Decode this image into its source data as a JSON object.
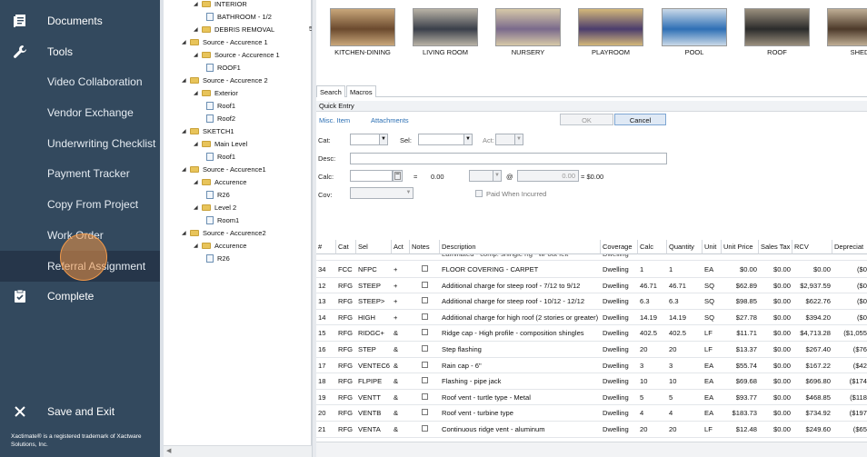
{
  "sidebar": {
    "documents": "Documents",
    "tools": "Tools",
    "subitems": [
      "Video Collaboration",
      "Vendor Exchange",
      "Underwriting Checklist",
      "Payment Tracker",
      "Copy From Project",
      "Work Order",
      "Referral Assignment"
    ],
    "complete": "Complete",
    "save_exit": "Save and Exit",
    "trademark": "Xactimate® is a registered trademark of Xactware Solutions, Inc."
  },
  "tree": [
    {
      "label": "INTERIOR",
      "type": "folder",
      "indent": 2
    },
    {
      "label": "BATHROOM - 1/2",
      "type": "doc",
      "indent": 3
    },
    {
      "label": "DEBRIS REMOVAL",
      "type": "folder",
      "indent": 2
    },
    {
      "label": "Source - Accurence 1",
      "type": "folder",
      "indent": 1
    },
    {
      "label": "Source - Accurence 1",
      "type": "folder",
      "indent": 2
    },
    {
      "label": "ROOF1",
      "type": "doc",
      "indent": 3
    },
    {
      "label": "Source - Accurence 2",
      "type": "folder",
      "indent": 1
    },
    {
      "label": "Exterior",
      "type": "folder",
      "indent": 2
    },
    {
      "label": "Roof1",
      "type": "doc",
      "indent": 3
    },
    {
      "label": "Roof2",
      "type": "doc",
      "indent": 3
    },
    {
      "label": "SKETCH1",
      "type": "folder",
      "indent": 1
    },
    {
      "label": "Main Level",
      "type": "folder",
      "indent": 2
    },
    {
      "label": "Roof1",
      "type": "doc",
      "indent": 3
    },
    {
      "label": "Source - Accurence1",
      "type": "folder",
      "indent": 1
    },
    {
      "label": "Accurence",
      "type": "folder",
      "indent": 2
    },
    {
      "label": "R26",
      "type": "doc",
      "indent": 3
    },
    {
      "label": "Level 2",
      "type": "folder",
      "indent": 2
    },
    {
      "label": "Room1",
      "type": "doc",
      "indent": 3
    },
    {
      "label": "Source - Accurence2",
      "type": "folder",
      "indent": 1
    },
    {
      "label": "Accurence",
      "type": "folder",
      "indent": 2
    },
    {
      "label": "R26",
      "type": "doc",
      "indent": 3
    }
  ],
  "tree_partial": "5",
  "thumbs": [
    {
      "label": "KITCHEN-DINING",
      "c1": "#6b4a2e",
      "c2": "#c9a77a"
    },
    {
      "label": "LIVING ROOM",
      "c1": "#3a3f4a",
      "c2": "#b9b3a6"
    },
    {
      "label": "NURSERY",
      "c1": "#7a6a8c",
      "c2": "#d7c9a8"
    },
    {
      "label": "PLAYROOM",
      "c1": "#4b3d6d",
      "c2": "#d4b87a"
    },
    {
      "label": "POOL",
      "c1": "#2e6fb5",
      "c2": "#c9d9e8"
    },
    {
      "label": "ROOF",
      "c1": "#2b2b2b",
      "c2": "#9a8f7d"
    },
    {
      "label": "SHED",
      "c1": "#4d3a2a",
      "c2": "#bfae95"
    }
  ],
  "tabs": [
    "Search",
    "Macros"
  ],
  "quick_entry": {
    "title": "Quick Entry",
    "misc_item": "Misc. Item",
    "attachments": "Attachments",
    "ok": "OK",
    "cancel": "Cancel",
    "cat_label": "Cat:",
    "sel_label": "Sel:",
    "act_label": "Act:",
    "desc_label": "Desc:",
    "calc_label": "Calc:",
    "cov_label": "Cov:",
    "eq1": "=",
    "calc_value": "0.00",
    "at": "@",
    "price_value": "0.00",
    "total": "= $0.00",
    "paid_when_incurred": "Paid When Incurred"
  },
  "grid": {
    "headers": [
      "#",
      "Cat",
      "Sel",
      "Act",
      "Notes",
      "Description",
      "Coverage",
      "Calc",
      "Quantity",
      "Unit",
      "Unit Price",
      "Sales Tax",
      "RCV",
      "Depreciat"
    ],
    "partial_row": [
      "",
      "",
      "",
      "",
      "",
      "Laminated - comp. shingle rfg - w/ out felt",
      "Dwelling",
      "",
      "",
      "",
      "",
      "",
      "",
      ""
    ],
    "rows": [
      [
        "34",
        "FCC",
        "NFPC",
        "+",
        "",
        "FLOOR COVERING - CARPET",
        "Dwelling",
        "1",
        "1",
        "EA",
        "$0.00",
        "$0.00",
        "$0.00",
        "($0"
      ],
      [
        "12",
        "RFG",
        "STEEP",
        "+",
        "",
        "Additional charge for steep roof - 7/12 to 9/12",
        "Dwelling",
        "46.71",
        "46.71",
        "SQ",
        "$62.89",
        "$0.00",
        "$2,937.59",
        "($0"
      ],
      [
        "13",
        "RFG",
        "STEEP>",
        "+",
        "",
        "Additional charge for steep roof - 10/12 - 12/12",
        "Dwelling",
        "6.3",
        "6.3",
        "SQ",
        "$98.85",
        "$0.00",
        "$622.76",
        "($0"
      ],
      [
        "14",
        "RFG",
        "HIGH",
        "+",
        "",
        "Additional charge for high roof (2 stories or greater)",
        "Dwelling",
        "14.19",
        "14.19",
        "SQ",
        "$27.78",
        "$0.00",
        "$394.20",
        "($0"
      ],
      [
        "15",
        "RFG",
        "RIDGC+",
        "&",
        "",
        "Ridge cap - High profile - composition shingles",
        "Dwelling",
        "402.5",
        "402.5",
        "LF",
        "$11.71",
        "$0.00",
        "$4,713.28",
        "($1,055"
      ],
      [
        "16",
        "RFG",
        "STEP",
        "&",
        "",
        "Step flashing",
        "Dwelling",
        "20",
        "20",
        "LF",
        "$13.37",
        "$0.00",
        "$267.40",
        "($76"
      ],
      [
        "17",
        "RFG",
        "VENTEC6",
        "&",
        "",
        "Rain cap - 6\"",
        "Dwelling",
        "3",
        "3",
        "EA",
        "$55.74",
        "$0.00",
        "$167.22",
        "($42"
      ],
      [
        "18",
        "RFG",
        "FLPIPE",
        "&",
        "",
        "Flashing - pipe jack",
        "Dwelling",
        "10",
        "10",
        "EA",
        "$69.68",
        "$0.00",
        "$696.80",
        "($174"
      ],
      [
        "19",
        "RFG",
        "VENTT",
        "&",
        "",
        "Roof vent - turtle type - Metal",
        "Dwelling",
        "5",
        "5",
        "EA",
        "$93.77",
        "$0.00",
        "$468.85",
        "($118"
      ],
      [
        "20",
        "RFG",
        "VENTB",
        "&",
        "",
        "Roof vent - turbine type",
        "Dwelling",
        "4",
        "4",
        "EA",
        "$183.73",
        "$0.00",
        "$734.92",
        "($197"
      ],
      [
        "21",
        "RFG",
        "VENTA",
        "&",
        "",
        "Continuous ridge vent - aluminum",
        "Dwelling",
        "20",
        "20",
        "LF",
        "$12.48",
        "$0.00",
        "$249.60",
        "($65"
      ]
    ]
  }
}
